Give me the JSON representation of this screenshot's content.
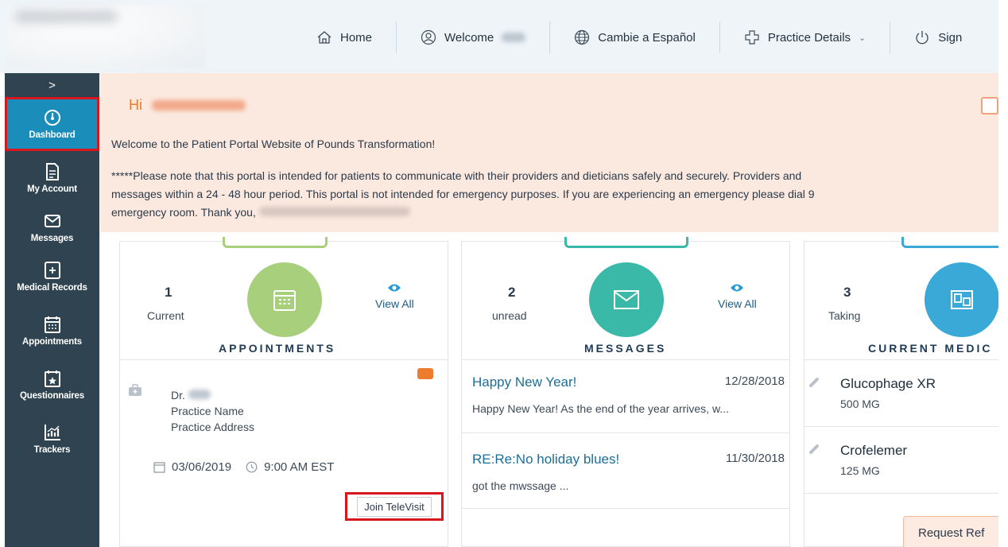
{
  "topnav": {
    "home": "Home",
    "welcome": "Welcome",
    "language": "Cambie a Español",
    "practice": "Practice Details",
    "signout": "Sign"
  },
  "sidebar": {
    "toggle": ">",
    "items": [
      {
        "label": "Dashboard",
        "icon": "dashboard-icon",
        "active": true
      },
      {
        "label": "My Account",
        "icon": "account-icon"
      },
      {
        "label": "Messages",
        "icon": "envelope-icon"
      },
      {
        "label": "Medical Records",
        "icon": "records-icon"
      },
      {
        "label": "Appointments",
        "icon": "calendar-icon"
      },
      {
        "label": "Questionnaires",
        "icon": "questionnaire-icon"
      },
      {
        "label": "Trackers",
        "icon": "chart-icon"
      }
    ]
  },
  "banner": {
    "greeting": "Hi",
    "welcome": "Welcome to the Patient Portal Website of Pounds Transformation!",
    "notice_line1": "*****Please note that this portal is intended for patients to communicate with their providers and dieticians safely and securely. Providers and",
    "notice_line2": "messages within a 24 - 48 hour period. This portal is not intended for emergency purposes. If you are experiencing an emergency please dial 9",
    "notice_line3": "emergency room. Thank you,"
  },
  "appointments": {
    "count": "1",
    "sub": "Current",
    "view_all": "View All",
    "title": "APPOINTMENTS",
    "doctor_prefix": "Dr.",
    "practice_name": "Practice Name",
    "practice_address": "Practice Address",
    "date": "03/06/2019",
    "time": "9:00 AM EST",
    "join": "Join TeleVisit",
    "accent": "#a7cf7c"
  },
  "messages": {
    "count": "2",
    "sub": "unread",
    "view_all": "View All",
    "title": "MESSAGES",
    "accent": "#3ab8a8",
    "items": [
      {
        "title": "Happy New Year!",
        "date": "12/28/2018",
        "body": "Happy New Year! As the end of the year arrives, w..."
      },
      {
        "title": "RE:Re:No holiday blues!",
        "date": "11/30/2018",
        "body": "got the mwssage ..."
      }
    ]
  },
  "medications": {
    "count": "3",
    "sub": "Taking",
    "title": "CURRENT MEDIC",
    "accent": "#3aa9d8",
    "items": [
      {
        "name": "Glucophage XR",
        "dose": "500 MG"
      },
      {
        "name": "Crofelemer",
        "dose": "125 MG"
      }
    ],
    "request": "Request Ref"
  }
}
